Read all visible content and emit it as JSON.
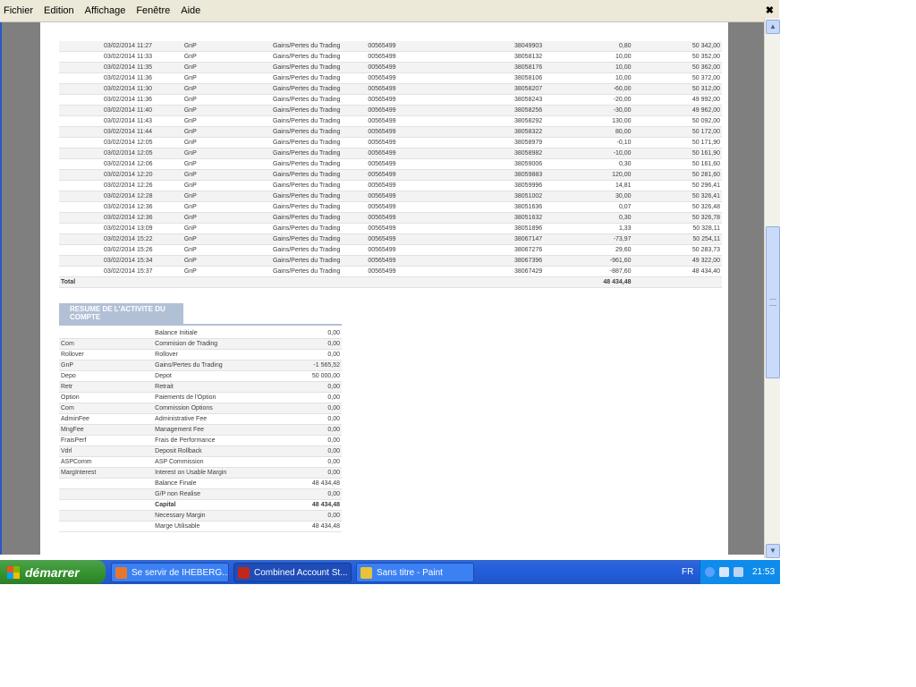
{
  "menu": [
    "Fichier",
    "Edition",
    "Affichage",
    "Fenêtre",
    "Aide"
  ],
  "transactions": [
    {
      "date": "03/02/2014 11:27",
      "type": "GnP",
      "desc": "Gains/Pertes du Trading",
      "account": "00565499",
      "ref": "38049903",
      "amount": "0,80",
      "balance": "50 342,00"
    },
    {
      "date": "03/02/2014 11:33",
      "type": "GnP",
      "desc": "Gains/Pertes du Trading",
      "account": "00565499",
      "ref": "38058132",
      "amount": "10,00",
      "balance": "50 352,00"
    },
    {
      "date": "03/02/2014 11:35",
      "type": "GnP",
      "desc": "Gains/Pertes du Trading",
      "account": "00565499",
      "ref": "38058176",
      "amount": "10,00",
      "balance": "50 362,00"
    },
    {
      "date": "03/02/2014 11:36",
      "type": "GnP",
      "desc": "Gains/Pertes du Trading",
      "account": "00565499",
      "ref": "38058106",
      "amount": "10,00",
      "balance": "50 372,00"
    },
    {
      "date": "03/02/2014 11:30",
      "type": "GnP",
      "desc": "Gains/Pertes du Trading",
      "account": "00565499",
      "ref": "38058207",
      "amount": "-60,00",
      "balance": "50 312,00"
    },
    {
      "date": "03/02/2014 11:36",
      "type": "GnP",
      "desc": "Gains/Pertes du Trading",
      "account": "00565499",
      "ref": "38058243",
      "amount": "-20,00",
      "balance": "49 992,00"
    },
    {
      "date": "03/02/2014 11:40",
      "type": "GnP",
      "desc": "Gains/Pertes du Trading",
      "account": "00565499",
      "ref": "38058256",
      "amount": "-30,00",
      "balance": "49 962,00"
    },
    {
      "date": "03/02/2014 11:43",
      "type": "GnP",
      "desc": "Gains/Pertes du Trading",
      "account": "00565499",
      "ref": "38058292",
      "amount": "130,00",
      "balance": "50 092,00"
    },
    {
      "date": "03/02/2014 11:44",
      "type": "GnP",
      "desc": "Gains/Pertes du Trading",
      "account": "00565499",
      "ref": "38058322",
      "amount": "80,00",
      "balance": "50 172,00"
    },
    {
      "date": "03/02/2014 12:05",
      "type": "GnP",
      "desc": "Gains/Pertes du Trading",
      "account": "00565499",
      "ref": "38058979",
      "amount": "-0,10",
      "balance": "50 171,90"
    },
    {
      "date": "03/02/2014 12:05",
      "type": "GnP",
      "desc": "Gains/Pertes du Trading",
      "account": "00565499",
      "ref": "38058982",
      "amount": "-10,00",
      "balance": "50 161,90"
    },
    {
      "date": "03/02/2014 12:06",
      "type": "GnP",
      "desc": "Gains/Pertes du Trading",
      "account": "00565499",
      "ref": "38059006",
      "amount": "0,30",
      "balance": "50 161,60"
    },
    {
      "date": "03/02/2014 12:20",
      "type": "GnP",
      "desc": "Gains/Pertes du Trading",
      "account": "00565499",
      "ref": "38059883",
      "amount": "120,00",
      "balance": "50 281,60"
    },
    {
      "date": "03/02/2014 12:26",
      "type": "GnP",
      "desc": "Gains/Pertes du Trading",
      "account": "00565499",
      "ref": "38059996",
      "amount": "14,81",
      "balance": "50 296,41"
    },
    {
      "date": "03/02/2014 12:28",
      "type": "GnP",
      "desc": "Gains/Pertes du Trading",
      "account": "00565499",
      "ref": "38051002",
      "amount": "30,00",
      "balance": "50 326,41"
    },
    {
      "date": "03/02/2014 12:36",
      "type": "GnP",
      "desc": "Gains/Pertes du Trading",
      "account": "00565499",
      "ref": "38051636",
      "amount": "0,07",
      "balance": "50 326,48"
    },
    {
      "date": "03/02/2014 12:36",
      "type": "GnP",
      "desc": "Gains/Pertes du Trading",
      "account": "00565499",
      "ref": "38051632",
      "amount": "0,30",
      "balance": "50 326,78"
    },
    {
      "date": "03/02/2014 13:09",
      "type": "GnP",
      "desc": "Gains/Pertes du Trading",
      "account": "00565499",
      "ref": "38051896",
      "amount": "1,33",
      "balance": "50 328,11"
    },
    {
      "date": "03/02/2014 15:22",
      "type": "GnP",
      "desc": "Gains/Pertes du Trading",
      "account": "00565499",
      "ref": "38067147",
      "amount": "-73,97",
      "balance": "50 254,11"
    },
    {
      "date": "03/02/2014 15:26",
      "type": "GnP",
      "desc": "Gains/Pertes du Trading",
      "account": "00565499",
      "ref": "38067276",
      "amount": "29,60",
      "balance": "50 283,73"
    },
    {
      "date": "03/02/2014 15:34",
      "type": "GnP",
      "desc": "Gains/Pertes du Trading",
      "account": "00565499",
      "ref": "38067396",
      "amount": "-961,60",
      "balance": "49 322,00"
    },
    {
      "date": "03/02/2014 15:37",
      "type": "GnP",
      "desc": "Gains/Pertes du Trading",
      "account": "00565499",
      "ref": "38067429",
      "amount": "-887,60",
      "balance": "48 434,40"
    }
  ],
  "total": {
    "label": "Total",
    "amount": "48 434,48"
  },
  "summary": {
    "title": "RESUME DE L'ACTIVITE DU COMPTE",
    "rows": [
      {
        "code": "",
        "label": "Balance Initiale",
        "value": "0,00",
        "bold": false
      },
      {
        "code": "Com",
        "label": "Commision de Trading",
        "value": "0,00",
        "bold": false
      },
      {
        "code": "Rollover",
        "label": "Rollover",
        "value": "0,00",
        "bold": false
      },
      {
        "code": "GnP",
        "label": "Gains/Pertes du Trading",
        "value": "-1 565,52",
        "bold": false
      },
      {
        "code": "Depo",
        "label": "Depot",
        "value": "50 000,00",
        "bold": false
      },
      {
        "code": "Retr",
        "label": "Retrait",
        "value": "0,00",
        "bold": false
      },
      {
        "code": "Option",
        "label": "Paiements de l'Option",
        "value": "0,00",
        "bold": false
      },
      {
        "code": "Com",
        "label": "Commission Options",
        "value": "0,00",
        "bold": false
      },
      {
        "code": "AdminFee",
        "label": "Administrative Fee",
        "value": "0,00",
        "bold": false
      },
      {
        "code": "MngFee",
        "label": "Management Fee",
        "value": "0,00",
        "bold": false
      },
      {
        "code": "FraisPerf",
        "label": "Frais de Performance",
        "value": "0,00",
        "bold": false
      },
      {
        "code": "Vdrl",
        "label": "Deposit Rollback",
        "value": "0,00",
        "bold": false
      },
      {
        "code": "ASPComm",
        "label": "ASP Commission",
        "value": "0,00",
        "bold": false
      },
      {
        "code": "MargInterest",
        "label": "Interest on Usable Margin",
        "value": "0,00",
        "bold": false
      },
      {
        "code": "",
        "label": "Balance Finale",
        "value": "48 434,48",
        "bold": false
      },
      {
        "code": "",
        "label": "G/P non Realise",
        "value": "0,00",
        "bold": false
      },
      {
        "code": "",
        "label": "Capital",
        "value": "48 434,48",
        "bold": true
      },
      {
        "code": "",
        "label": "Necessary Margin",
        "value": "0,00",
        "bold": false
      },
      {
        "code": "",
        "label": "Marge Utilisable",
        "value": "48 434,48",
        "bold": false
      }
    ]
  },
  "taskbar": {
    "start_label": "démarrer",
    "tasks": [
      {
        "label": "Se servir de IHEBERG...",
        "icon": "firefox-icon",
        "color": "#e8772e"
      },
      {
        "label": "Combined Account St...",
        "icon": "pdf-icon",
        "color": "#c0281c"
      },
      {
        "label": "Sans titre - Paint",
        "icon": "paint-icon",
        "color": "#e8c23a"
      }
    ],
    "lang": "FR",
    "clock": "21:53"
  }
}
